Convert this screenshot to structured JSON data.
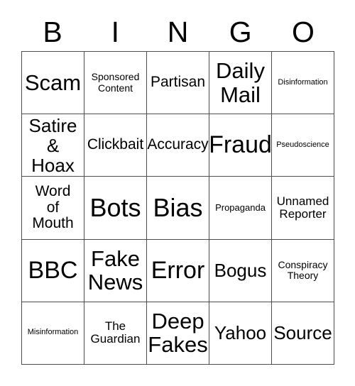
{
  "card": {
    "title": "BINGO",
    "header_letters": [
      "B",
      "I",
      "N",
      "G",
      "O"
    ],
    "colors": {
      "background": "#ffffff",
      "text": "#000000",
      "border": "#4d4d4d"
    },
    "grid": {
      "rows": 5,
      "columns": 5,
      "cells": [
        {
          "text": "Scam",
          "size": "lg"
        },
        {
          "text": "Sponsored\nContent",
          "size": "xxs"
        },
        {
          "text": "Partisan",
          "size": "sm"
        },
        {
          "text": "Daily\nMail",
          "size": "lg"
        },
        {
          "text": "Disinformation",
          "size": "mini"
        },
        {
          "text": "Satire\n& Hoax",
          "size": "md"
        },
        {
          "text": "Clickbait",
          "size": "sm"
        },
        {
          "text": "Accuracy",
          "size": "sm"
        },
        {
          "text": "Fraud",
          "size": "xl"
        },
        {
          "text": "Pseudoscience",
          "size": "mini"
        },
        {
          "text": "Word\nof\nMouth",
          "size": "sm"
        },
        {
          "text": "Bots",
          "size": "xxl"
        },
        {
          "text": "Bias",
          "size": "xxl"
        },
        {
          "text": "Propaganda",
          "size": "tiny"
        },
        {
          "text": "Unnamed\nReporter",
          "size": "xs"
        },
        {
          "text": "BBC",
          "size": "xl"
        },
        {
          "text": "Fake\nNews",
          "size": "lg"
        },
        {
          "text": "Error",
          "size": "xl"
        },
        {
          "text": "Bogus",
          "size": "md"
        },
        {
          "text": "Conspiracy\nTheory",
          "size": "xxs"
        },
        {
          "text": "Misinformation",
          "size": "mini"
        },
        {
          "text": "The\nGuardian",
          "size": "xs"
        },
        {
          "text": "Deep\nFakes",
          "size": "lg"
        },
        {
          "text": "Yahoo",
          "size": "md"
        },
        {
          "text": "Source",
          "size": "md"
        }
      ]
    }
  }
}
